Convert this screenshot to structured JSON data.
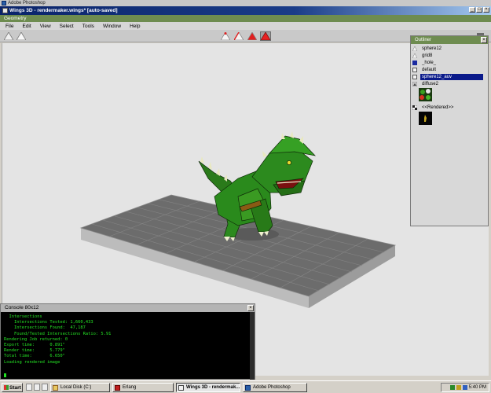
{
  "photoshop": {
    "title": "Adobe Photoshop"
  },
  "wings_window": {
    "title": "Wings 3D - rendermaker.wings* [auto-saved]",
    "subtitle": "Geometry",
    "controls": {
      "minimize": "_",
      "maximize": "□",
      "close": "×"
    }
  },
  "menu": [
    "File",
    "Edit",
    "View",
    "Select",
    "Tools",
    "Window",
    "Help"
  ],
  "toolbar": {
    "buttons": [
      "vertex-mode",
      "edge-mode",
      "face-mode",
      "body-mode"
    ],
    "active_mode": "body-mode",
    "icon_colors": {
      "white": "#f4f4f4",
      "red": "#e02020"
    }
  },
  "outliner": {
    "title": "Outliner",
    "close": "×",
    "items": [
      {
        "label": "sphere12",
        "icon": "white-triangle-icon"
      },
      {
        "label": "grid8",
        "icon": "white-triangle-icon"
      },
      {
        "label": "_hole_",
        "icon": "material-blue-icon"
      },
      {
        "label": "default",
        "icon": "material-icon"
      },
      {
        "label": "sphere12_auv",
        "icon": "material-icon",
        "selected": true
      },
      {
        "label": "diffuse2",
        "icon": "texture-icon"
      },
      {
        "label": "<<Rendered>>",
        "icon": "render-icon"
      }
    ]
  },
  "console": {
    "title": "Console 80x12",
    "close": "×",
    "lines": [
      "  Intersections",
      "    Intersections Tested: 1,660,433",
      "    Intersections Found:  47,187",
      "    Found/Tested Intersections Ratio: 5.91",
      "",
      "Rendering Job returned: 0",
      "Export time:      0.891\"",
      "Render time:      5.779\"",
      "Total time:       6.650\"",
      "Loading rendered image"
    ]
  },
  "taskbar": {
    "start": "Start",
    "tasks": [
      {
        "label": "Local Disk (C:)",
        "icon": "folder-icon"
      },
      {
        "label": "Erlang",
        "icon": "erlang-icon"
      },
      {
        "label": "Wings 3D - rendermak...",
        "icon": "wings-icon",
        "active": true
      },
      {
        "label": "Adobe Photoshop",
        "icon": "photoshop-icon"
      }
    ],
    "clock": "5:40 PM"
  },
  "colors": {
    "title_blue": "#0a246a",
    "panel_green": "#6e8c50",
    "console_text": "#24e024",
    "dino_green": "#2c8a1e",
    "selection_blue": "#0a1a8a"
  }
}
